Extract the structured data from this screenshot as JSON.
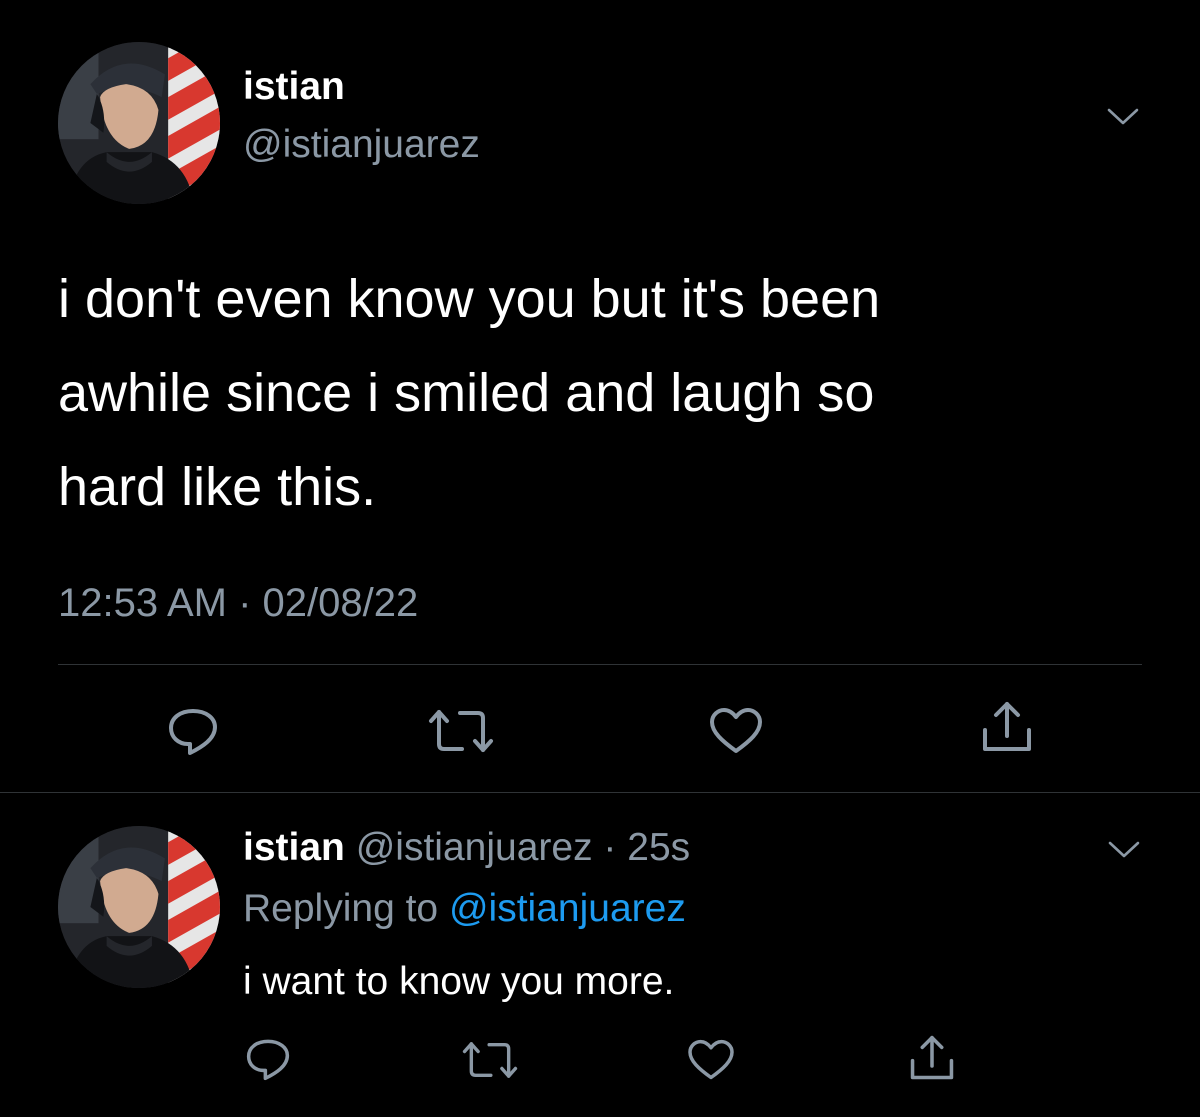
{
  "main_tweet": {
    "display_name": "istian",
    "handle": "@istianjuarez",
    "text_lines": [
      "i don't even know you but it's been",
      "awhile since i smiled and laugh so",
      "hard like this."
    ],
    "timestamp": "12:53 AM · 02/08/22"
  },
  "reply": {
    "display_name": "istian",
    "handle": "@istianjuarez",
    "separator": "·",
    "time_ago": "25s",
    "replying_prefix": "Replying to",
    "replying_handle": "@istianjuarez",
    "text": "i want to know you more."
  },
  "icons": {
    "menu": "chevron-down-icon",
    "reply": "reply-icon",
    "retweet": "retweet-icon",
    "like": "heart-icon",
    "share": "share-icon"
  },
  "colors": {
    "background": "#000000",
    "text": "#ffffff",
    "secondary": "#8b98a5",
    "link": "#1d9bf0",
    "divider": "#2f3336"
  }
}
